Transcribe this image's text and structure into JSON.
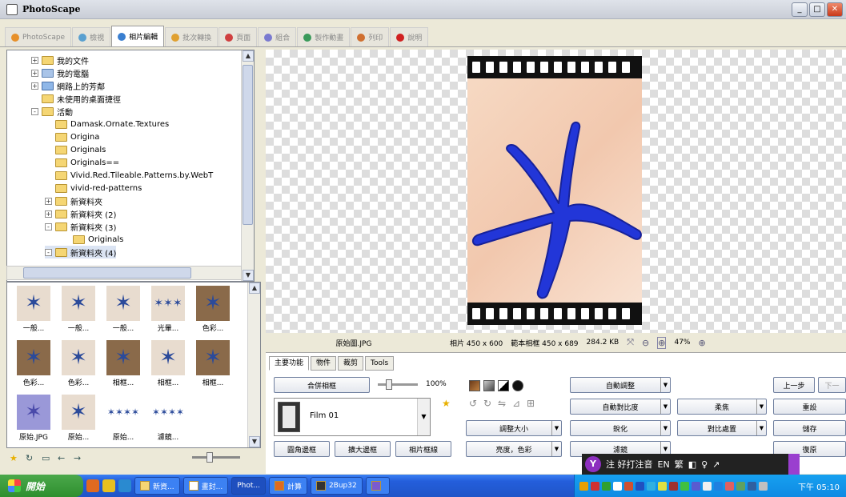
{
  "window": {
    "title": "PhotoScape"
  },
  "tabs": [
    {
      "label": "PhotoScape",
      "active": false
    },
    {
      "label": "檢視",
      "active": false
    },
    {
      "label": "相片編輯",
      "active": true
    },
    {
      "label": "批次轉換",
      "active": false
    },
    {
      "label": "頁面",
      "active": false
    },
    {
      "label": "組合",
      "active": false
    },
    {
      "label": "製作動畫",
      "active": false
    },
    {
      "label": "列印",
      "active": false
    },
    {
      "label": "說明",
      "active": false
    }
  ],
  "tree": [
    {
      "label": "我的文件",
      "level": 1,
      "expander": "+"
    },
    {
      "label": "我的電腦",
      "level": 1,
      "expander": "+"
    },
    {
      "label": "網路上的芳鄰",
      "level": 1,
      "expander": "+"
    },
    {
      "label": "未使用的桌面捷徑",
      "level": 1,
      "expander": ""
    },
    {
      "label": "活動",
      "level": 1,
      "expander": "-"
    },
    {
      "label": "Damask.Ornate.Textures",
      "level": 2,
      "expander": ""
    },
    {
      "label": "Origina",
      "level": 2,
      "expander": ""
    },
    {
      "label": "Originals",
      "level": 2,
      "expander": ""
    },
    {
      "label": "Originals==",
      "level": 2,
      "expander": ""
    },
    {
      "label": "Vivid.Red.Tileable.Patterns.by.WebT",
      "level": 2,
      "expander": ""
    },
    {
      "label": "vivid-red-patterns",
      "level": 2,
      "expander": ""
    },
    {
      "label": "新資料夾",
      "level": 2,
      "expander": "+"
    },
    {
      "label": "新資料夾 (2)",
      "level": 2,
      "expander": "+"
    },
    {
      "label": "新資料夾 (3)",
      "level": 2,
      "expander": "-"
    },
    {
      "label": "Originals",
      "level": 3,
      "expander": ""
    },
    {
      "label": "新資料夾 (4)",
      "level": 2,
      "expander": "-"
    }
  ],
  "thumbnails": [
    {
      "label": "一般..."
    },
    {
      "label": "一般..."
    },
    {
      "label": "一般..."
    },
    {
      "label": "光暈..."
    },
    {
      "label": "色彩..."
    },
    {
      "label": "色彩..."
    },
    {
      "label": "色彩..."
    },
    {
      "label": "相框..."
    },
    {
      "label": "相框..."
    },
    {
      "label": "相框..."
    },
    {
      "label": "原始.JPG"
    },
    {
      "label": "原始..."
    },
    {
      "label": "原始..."
    },
    {
      "label": "濾鏡..."
    }
  ],
  "info": {
    "filename": "原始圖.JPG",
    "photo_size": "相片 450 x 600",
    "frame_size": "範本相框 450 x 689",
    "file_size": "284.2 KB",
    "zoom": "47%"
  },
  "panel": {
    "tabs": [
      "主要功能",
      "物件",
      "裁剪",
      "Tools"
    ],
    "frame_btn": "合併相框",
    "frame_pct": "100%",
    "frame_name": "Film 01",
    "resize": "調整大小",
    "brightness": "亮度，色彩",
    "round": "圓角邊框",
    "margin": "擴大邊框",
    "photo_frame": "相片框線",
    "auto_level": "自動調整",
    "auto_contrast": "自動對比度",
    "sharpen": "銳化",
    "filter": "濾鏡",
    "blur": "柔焦",
    "backlight": "對比處置",
    "prev": "上一步",
    "next": "下一",
    "redo": "重設",
    "save": "儲存",
    "restore": "復原"
  },
  "ime": {
    "label": "注 好打注音",
    "lang": "EN",
    "trad": "繁"
  },
  "taskbar": {
    "start": "開始",
    "tasks": [
      "新資...",
      "畫封...",
      "Phot...",
      "計算",
      "2Bup32",
      ""
    ],
    "clock": "下午 05:10"
  }
}
